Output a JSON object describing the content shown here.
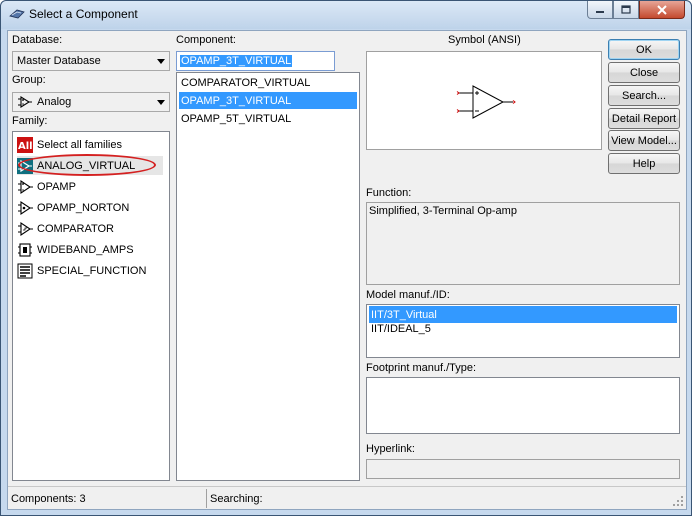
{
  "window": {
    "title": "Select a Component"
  },
  "database": {
    "label": "Database:",
    "value": "Master Database"
  },
  "group": {
    "label": "Group:",
    "value": "Analog"
  },
  "family": {
    "label": "Family:",
    "items": [
      {
        "label": "Select all families",
        "icon": "all-families-icon"
      },
      {
        "label": "ANALOG_VIRTUAL",
        "icon": "analog-virtual-icon",
        "selected": true
      },
      {
        "label": "OPAMP",
        "icon": "opamp-icon"
      },
      {
        "label": "OPAMP_NORTON",
        "icon": "opamp-norton-icon"
      },
      {
        "label": "COMPARATOR",
        "icon": "comparator-icon"
      },
      {
        "label": "WIDEBAND_AMPS",
        "icon": "wideband-amps-icon"
      },
      {
        "label": "SPECIAL_FUNCTION",
        "icon": "special-function-icon"
      }
    ]
  },
  "component": {
    "label": "Component:",
    "input_value": "OPAMP_3T_VIRTUAL",
    "items": [
      {
        "label": "COMPARATOR_VIRTUAL"
      },
      {
        "label": "OPAMP_3T_VIRTUAL",
        "selected": true
      },
      {
        "label": "OPAMP_5T_VIRTUAL"
      }
    ]
  },
  "symbol": {
    "label": "Symbol (ANSI)",
    "icon": "opamp-symbol-icon"
  },
  "function": {
    "label": "Function:",
    "text": "Simplified, 3-Terminal Op-amp"
  },
  "model": {
    "label": "Model manuf./ID:",
    "items": [
      {
        "label": "IIT/3T_Virtual",
        "selected": true
      },
      {
        "label": "IIT/IDEAL_5"
      }
    ]
  },
  "footprint": {
    "label": "Footprint manuf./Type:"
  },
  "hyperlink": {
    "label": "Hyperlink:"
  },
  "buttons": {
    "ok": "OK",
    "close": "Close",
    "search": "Search...",
    "detail_report": "Detail Report",
    "view_model": "View Model...",
    "help": "Help"
  },
  "status": {
    "components": "Components: 3",
    "searching": "Searching:"
  },
  "colors": {
    "selection": "#3399ff",
    "annotation": "#d42020",
    "window_frame": "#c6d9ee"
  }
}
